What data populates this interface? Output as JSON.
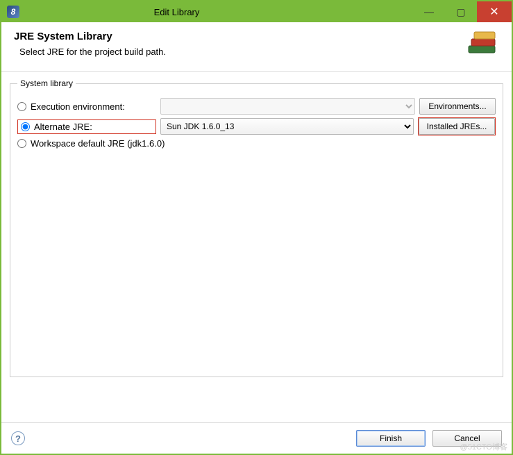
{
  "window": {
    "title": "Edit Library",
    "app_icon_char": "8"
  },
  "header": {
    "title": "JRE System Library",
    "subtitle": "Select JRE for the project build path."
  },
  "fieldset": {
    "legend": "System library",
    "execution_env": {
      "label": "Execution environment:",
      "selected": "",
      "button": "Environments..."
    },
    "alternate_jre": {
      "label": "Alternate JRE:",
      "selected": "Sun JDK 1.6.0_13",
      "button": "Installed JREs..."
    },
    "workspace_default": {
      "label": "Workspace default JRE (jdk1.6.0)"
    },
    "selected_radio": "alternate_jre"
  },
  "footer": {
    "finish": "Finish",
    "cancel": "Cancel"
  },
  "watermark": "@51CTO博客"
}
